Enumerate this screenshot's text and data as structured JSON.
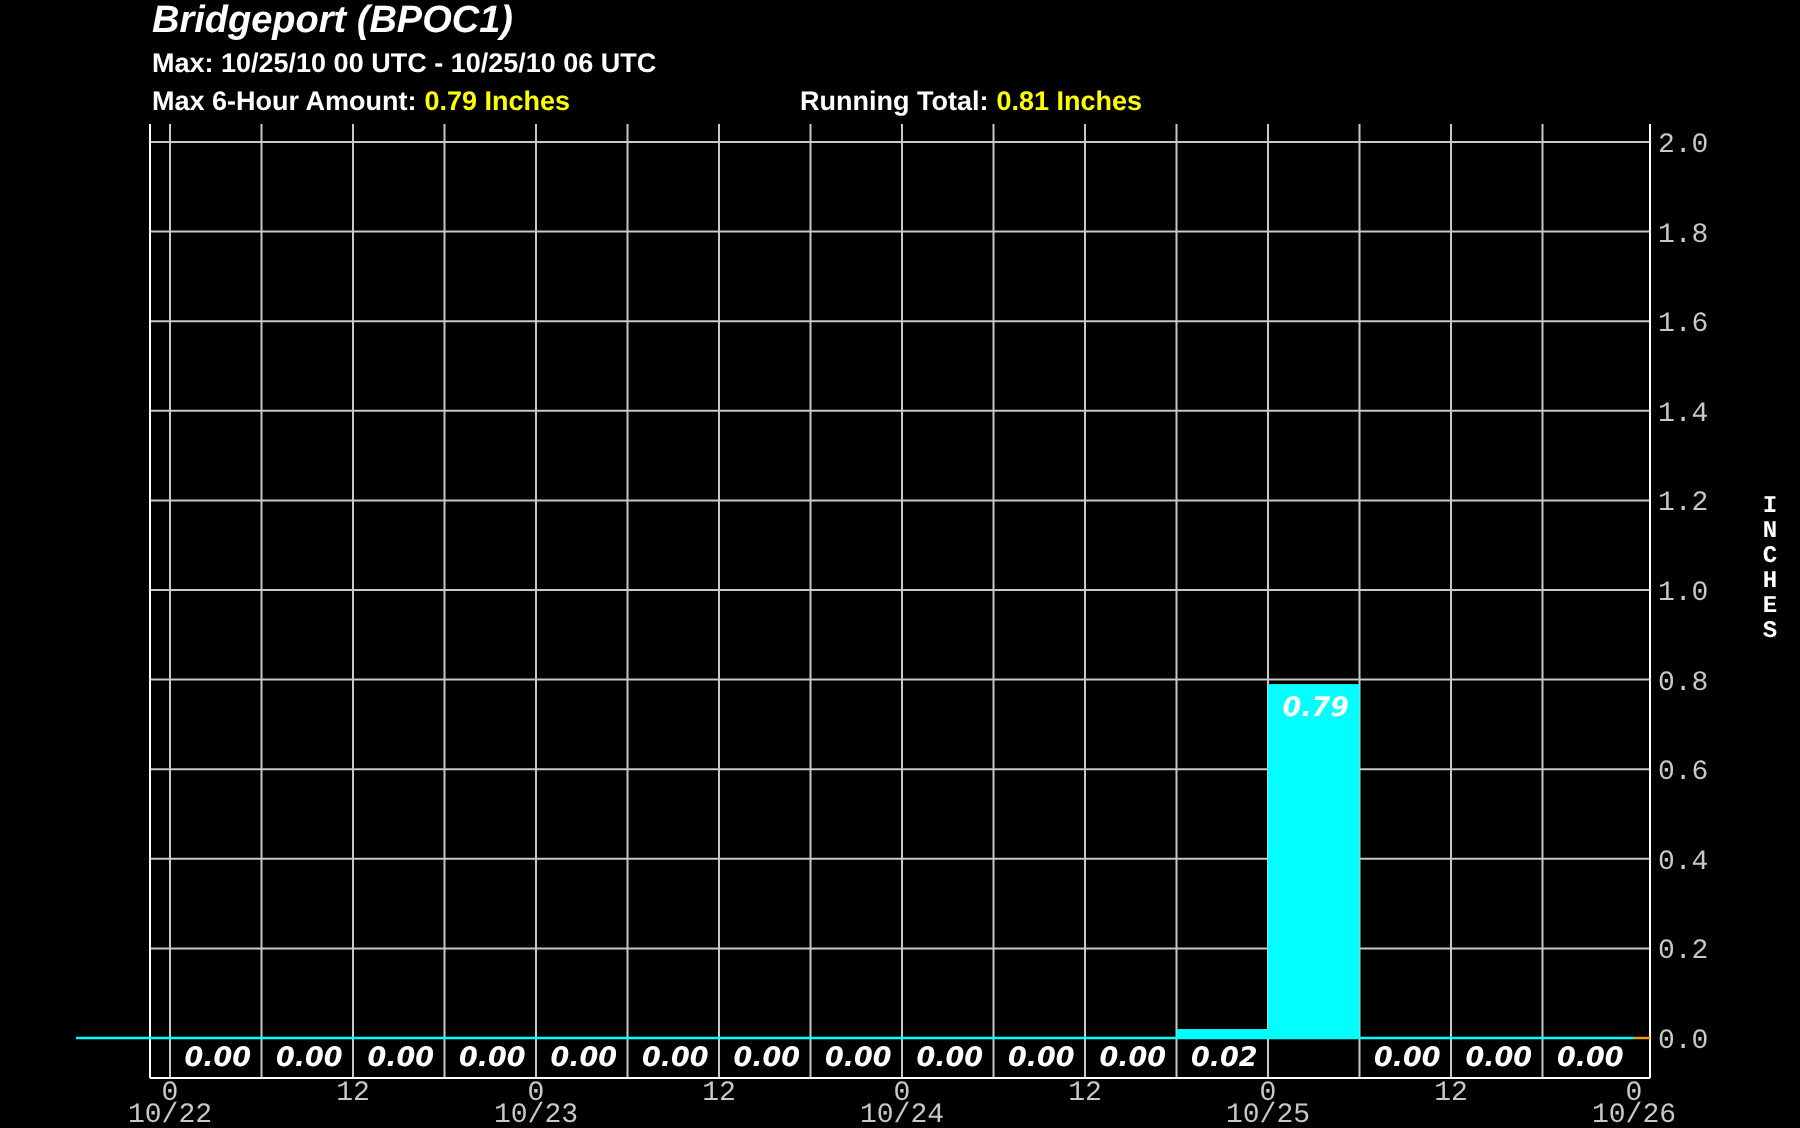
{
  "header": {
    "title": "Bridgeport (BPOC1)",
    "max_period": "Max: 10/25/10 00 UTC - 10/25/10 06 UTC",
    "max_amount_label": "Max 6-Hour Amount:",
    "max_amount_value": "0.79 Inches",
    "running_total_label": "Running Total:",
    "running_total_value": "0.81 Inches"
  },
  "chart": {
    "chart_data": {
      "type": "bar",
      "ylabel": "INCHES",
      "ylim": [
        0,
        2.0
      ],
      "grid": true,
      "yticks": [
        {
          "value": 0,
          "label": "0.0"
        },
        {
          "value": 0.2,
          "label": "0.2"
        },
        {
          "value": 0.4,
          "label": "0.4"
        },
        {
          "value": 0.6,
          "label": "0.6"
        },
        {
          "value": 0.8,
          "label": "0.8"
        },
        {
          "value": 1.0,
          "label": "1.0"
        },
        {
          "value": 1.2,
          "label": "1.2"
        },
        {
          "value": 1.4,
          "label": "1.4"
        },
        {
          "value": 1.6,
          "label": "1.6"
        },
        {
          "value": 1.8,
          "label": "1.8"
        },
        {
          "value": 2.0,
          "label": "2.0"
        }
      ],
      "series": [
        {
          "color": "#00ffff",
          "values": [
            0,
            0,
            0,
            0,
            0,
            0,
            0,
            0,
            0,
            0,
            0,
            0.02,
            0.79,
            0,
            0,
            0
          ]
        }
      ],
      "value_labels": [
        "0.00",
        "0.00",
        "0.00",
        "0.00",
        "0.00",
        "0.00",
        "0.00",
        "0.00",
        "0.00",
        "0.00",
        "0.00",
        "0.02",
        "0.79",
        "0.00",
        "0.00",
        "0.00"
      ]
    },
    "x_axis": {
      "hour_labels": [
        "0",
        "12",
        "0",
        "12",
        "0",
        "12",
        "0",
        "12",
        "0"
      ],
      "date_labels": [
        "10/22",
        "10/23",
        "10/24",
        "10/25",
        "10/26"
      ]
    }
  }
}
